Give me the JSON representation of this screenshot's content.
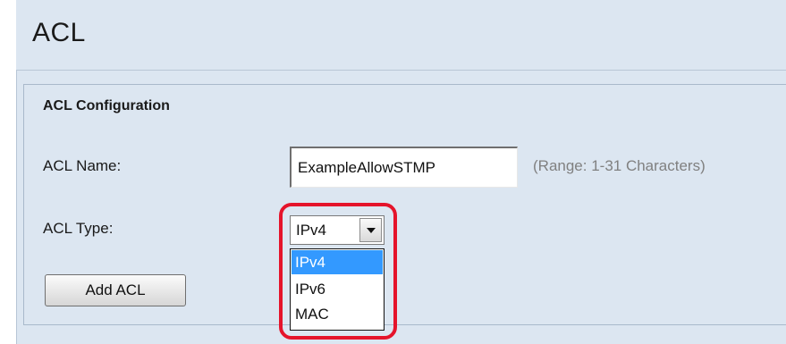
{
  "page": {
    "title": "ACL"
  },
  "acl_configuration": {
    "section_title": "ACL Configuration",
    "name_label": "ACL Name:",
    "name_value": "ExampleAllowSTMP",
    "name_hint": "(Range: 1-31 Characters)",
    "type_label": "ACL Type:",
    "type_selected": "IPv4",
    "type_options": [
      "IPv4",
      "IPv6",
      "MAC"
    ],
    "add_button_label": "Add ACL"
  },
  "colors": {
    "panel_background": "#dce6f1",
    "highlight_ring": "#e5142b",
    "option_selected": "#3399ff",
    "hint_text": "#808080"
  }
}
